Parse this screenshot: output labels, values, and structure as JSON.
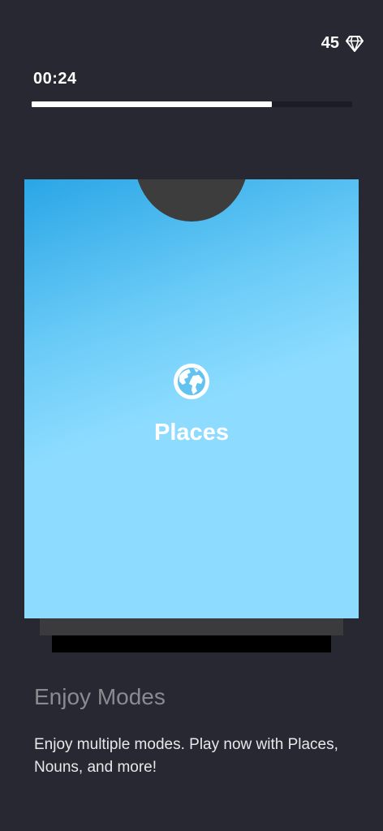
{
  "header": {
    "gem_count": "45",
    "gem_icon": "diamond-icon",
    "timer": "00:24",
    "progress": 0.75
  },
  "card": {
    "icon": "globe-icon",
    "title": "Places",
    "gradient_colors": [
      "#2aa6e6",
      "#8ddcff"
    ]
  },
  "info": {
    "title": "Enjoy Modes",
    "description": "Enjoy multiple modes. Play now with Places, Nouns, and more!"
  },
  "colors": {
    "background": "#272832",
    "card_notch": "#3d3d3d"
  }
}
